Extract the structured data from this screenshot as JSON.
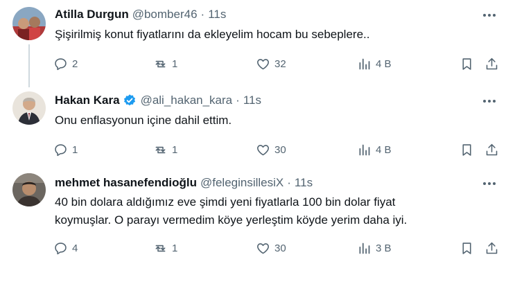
{
  "tweets": [
    {
      "name": "Atilla Durgun",
      "handle": "@bomber46",
      "dot": "·",
      "time": "11s",
      "verified": false,
      "text": "Şişirilmiş konut fiyatlarını da ekleyelim hocam bu sebeplere..",
      "replies": "2",
      "retweets": "1",
      "likes": "32",
      "views": "4 B"
    },
    {
      "name": "Hakan Kara",
      "handle": "@ali_hakan_kara",
      "dot": "·",
      "time": "11s",
      "verified": true,
      "text": "Onu enflasyonun içine dahil ettim.",
      "replies": "1",
      "retweets": "1",
      "likes": "30",
      "views": "4 B"
    },
    {
      "name": "mehmet hasanefendioğlu",
      "handle": "@feleginsillesiX",
      "dot": "·",
      "time": "11s",
      "verified": false,
      "text_line1": "40 bin dolara aldığımız eve şimdi yeni fiyatlarla 100 bin dolar fiyat",
      "text_line2": "koymuşlar. O parayı vermedim köye yerleştim köyde yerim daha iyi.",
      "replies": "4",
      "retweets": "1",
      "likes": "30",
      "views": "3 B"
    }
  ],
  "colors": {
    "text_primary": "#0f1419",
    "text_secondary": "#536471",
    "verified_blue": "#1d9bf0",
    "thread_line": "#cfd9de"
  },
  "icons": [
    "more-icon",
    "reply-icon",
    "retweet-icon",
    "like-icon",
    "views-icon",
    "bookmark-icon",
    "share-icon",
    "verified-badge-icon"
  ]
}
